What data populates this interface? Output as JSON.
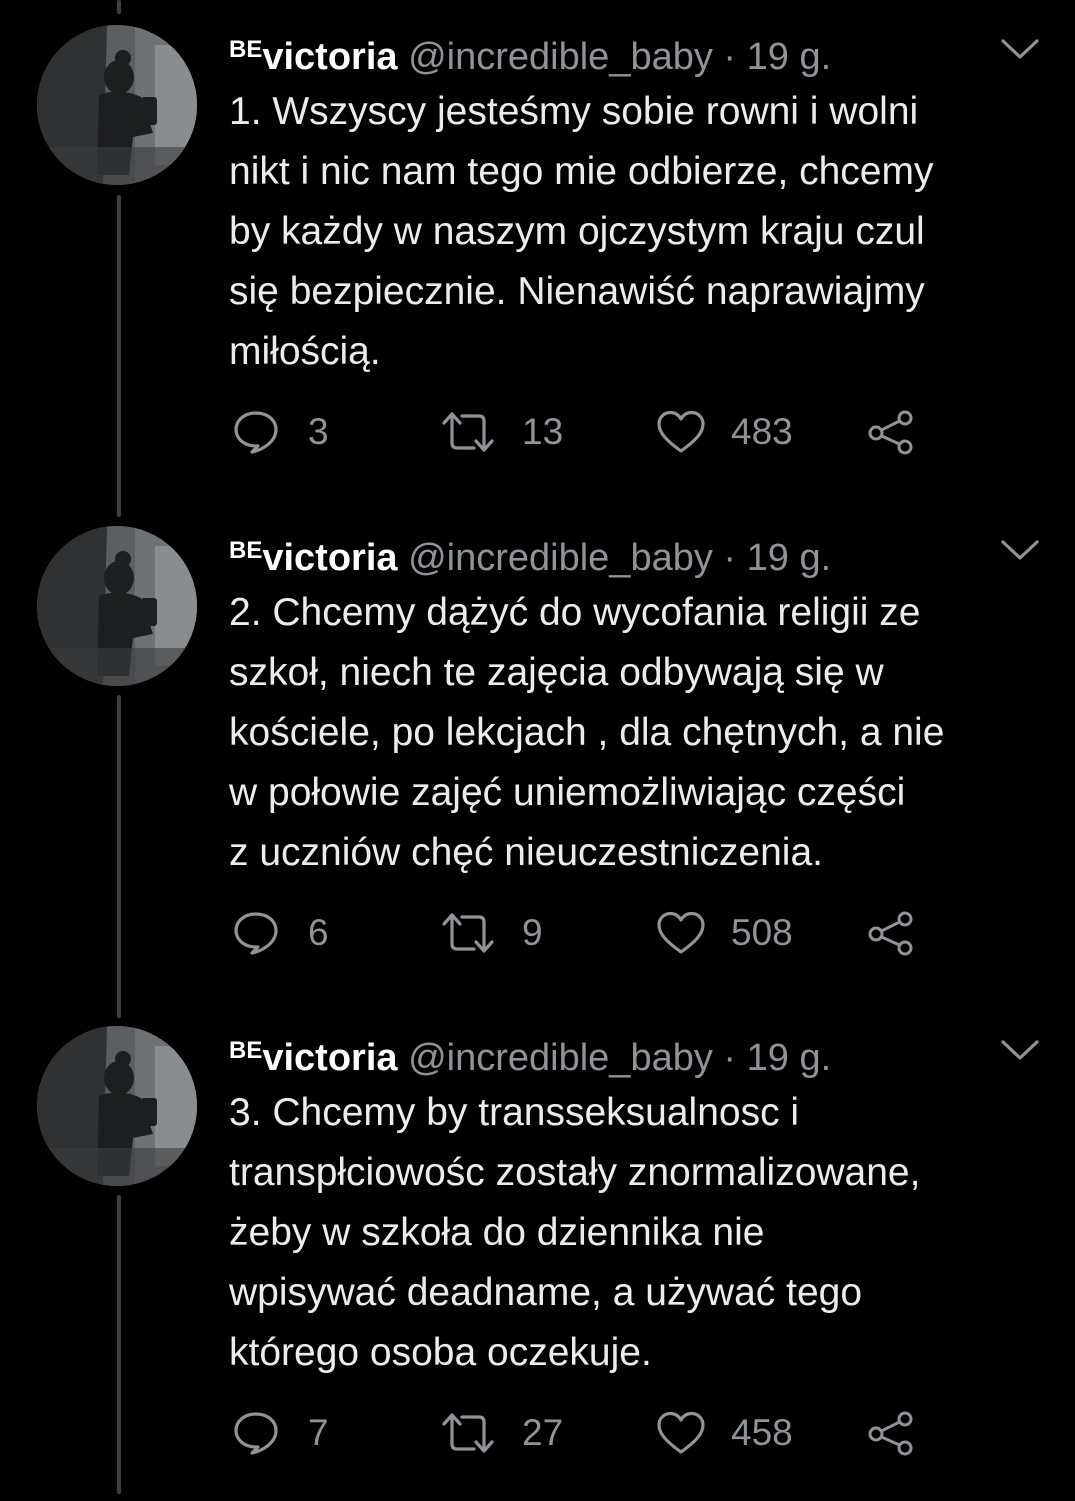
{
  "colors": {
    "background": "#000000",
    "text_primary": "#ececec",
    "text_secondary": "#8f9499",
    "thread_line": "#3d4145"
  },
  "tweets": [
    {
      "author": {
        "prefix": "BE",
        "name": "victoria",
        "handle": "@incredible_baby",
        "separator": "·",
        "time": "19 g."
      },
      "lines": [
        "1. Wszyscy jesteśmy sobie rowni i wolni",
        "nikt i nic nam tego mie odbierze, chcemy",
        "by każdy w naszym ojczystym kraju czul",
        "się bezpiecznie. Nienawiść naprawiajmy",
        "miłością."
      ],
      "replies": "3",
      "retweets": "13",
      "likes": "483",
      "icons": [
        "reply-icon",
        "retweet-icon",
        "like-icon",
        "share-icon",
        "chevron-down-icon"
      ]
    },
    {
      "author": {
        "prefix": "BE",
        "name": "victoria",
        "handle": "@incredible_baby",
        "separator": "·",
        "time": "19 g."
      },
      "lines": [
        "2. Chcemy dążyć do wycofania religii ze",
        "szkoł, niech te zajęcia odbywają się w",
        "kościele, po lekcjach , dla chętnych, a nie",
        "w połowie zajęć uniemożliwiając części",
        "z uczniów chęć nieuczestniczenia."
      ],
      "replies": "6",
      "retweets": "9",
      "likes": "508",
      "icons": [
        "reply-icon",
        "retweet-icon",
        "like-icon",
        "share-icon",
        "chevron-down-icon"
      ]
    },
    {
      "author": {
        "prefix": "BE",
        "name": "victoria",
        "handle": "@incredible_baby",
        "separator": "·",
        "time": "19 g."
      },
      "lines": [
        "3. Chcemy by transseksualnosc i",
        "transpłciowośc zostały znormalizowane,",
        "żeby w szkoła do dziennika nie",
        "wpisywać deadname, a używać tego",
        "którego osoba oczekuje."
      ],
      "replies": "7",
      "retweets": "27",
      "likes": "458",
      "icons": [
        "reply-icon",
        "retweet-icon",
        "like-icon",
        "share-icon",
        "chevron-down-icon"
      ]
    }
  ]
}
